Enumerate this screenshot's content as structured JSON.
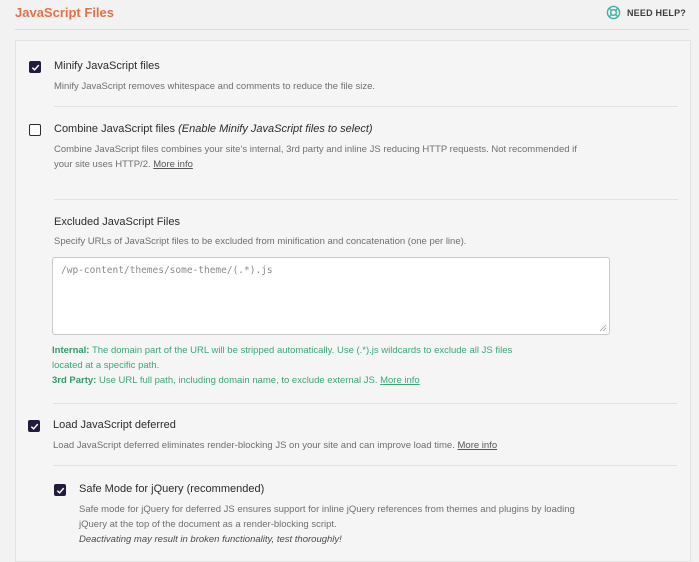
{
  "header": {
    "title": "JavaScript Files",
    "help_label": "NEED HELP?"
  },
  "options": {
    "minify": {
      "checked": true,
      "label": "Minify JavaScript files",
      "description": "Minify JavaScript removes whitespace and comments to reduce the file size."
    },
    "combine": {
      "checked": false,
      "label": "Combine JavaScript files",
      "label_note": "(Enable Minify JavaScript files to select)",
      "description_line1": "Combine JavaScript files combines your site’s internal, 3rd party and inline JS reducing HTTP requests. Not recommended if",
      "description_line2": "your site uses HTTP/2.",
      "more_info": "More info"
    },
    "excluded": {
      "title": "Excluded JavaScript Files",
      "description": "Specify URLs of JavaScript files to be excluded from minification and concatenation (one per line).",
      "placeholder": "/wp-content/themes/some-theme/(.*).js",
      "internal_label": "Internal:",
      "internal_text_line1": "The domain part of the URL will be stripped automatically. Use (.*).js wildcards to exclude all JS files",
      "internal_text_line2": "located at a specific path.",
      "thirdparty_label": "3rd Party:",
      "thirdparty_text": "Use URL full path, including domain name, to exclude external JS.",
      "more_info": "More info"
    },
    "defer": {
      "checked": true,
      "label": "Load JavaScript deferred",
      "description": "Load JavaScript deferred eliminates render-blocking JS on your site and can improve load time.",
      "more_info": "More info"
    },
    "jquery": {
      "checked": true,
      "label": "Safe Mode for jQuery (recommended)",
      "description_line1": "Safe mode for jQuery for deferred JS ensures support for inline jQuery references from themes and plugins by loading",
      "description_line2": "jQuery at the top of the document as a render-blocking script.",
      "warning": "Deactivating may result in broken functionality, test thoroughly!"
    }
  },
  "colors": {
    "accent": "#e0724a",
    "checkbox": "#1f1d3b",
    "note_green": "#3aa87a",
    "help_teal": "#3fb2a5"
  }
}
